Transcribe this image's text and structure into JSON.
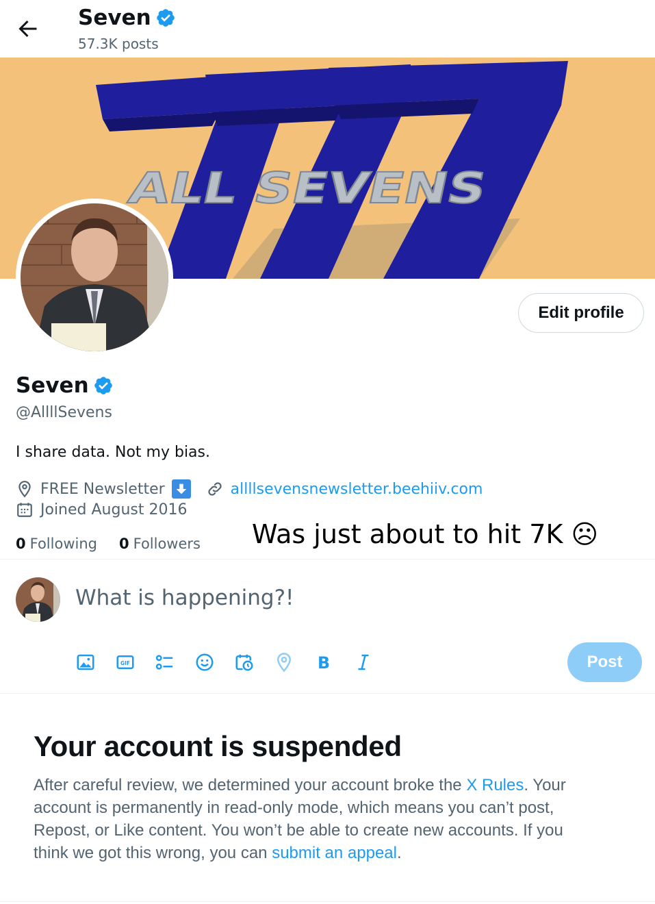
{
  "header": {
    "name": "Seven",
    "posts": "57.3K posts"
  },
  "banner": {
    "logo_text": "ALL SEVENS",
    "colors": {
      "background": "#f3c17a",
      "sevens": "#1f1f9e",
      "text": "#b9bfc6"
    }
  },
  "profile": {
    "edit_label": "Edit profile",
    "name": "Seven",
    "handle": "@AllllSevens",
    "bio": "I share data. Not my bias.",
    "location": "FREE Newsletter",
    "website": "allllsevensnewsletter.beehiiv.com",
    "joined": "Joined August 2016",
    "following_count": "0",
    "following_label": "Following",
    "followers_count": "0",
    "followers_label": "Followers"
  },
  "annotation": "Was just about to hit 7K ☹",
  "composer": {
    "placeholder": "What is happening?!",
    "post_label": "Post",
    "tools": [
      "image-icon",
      "gif-icon",
      "poll-icon",
      "emoji-icon",
      "schedule-icon",
      "location-icon",
      "bold-icon",
      "italic-icon"
    ]
  },
  "suspension": {
    "title": "Your account is suspended",
    "body_before_rules": "After careful review, we determined your account broke the ",
    "rules_link": "X Rules",
    "body_middle": ". Your account is permanently in read-only mode, which means you can’t post, Repost, or Like content. You won’t be able to create new accounts. If you think we got this wrong, you can ",
    "appeal_link": "submit an appeal",
    "body_end": "."
  },
  "colors": {
    "accent": "#1d9bf0",
    "muted": "#536471",
    "verified": "#1d9bf0",
    "post_disabled": "#8ecdf8"
  }
}
